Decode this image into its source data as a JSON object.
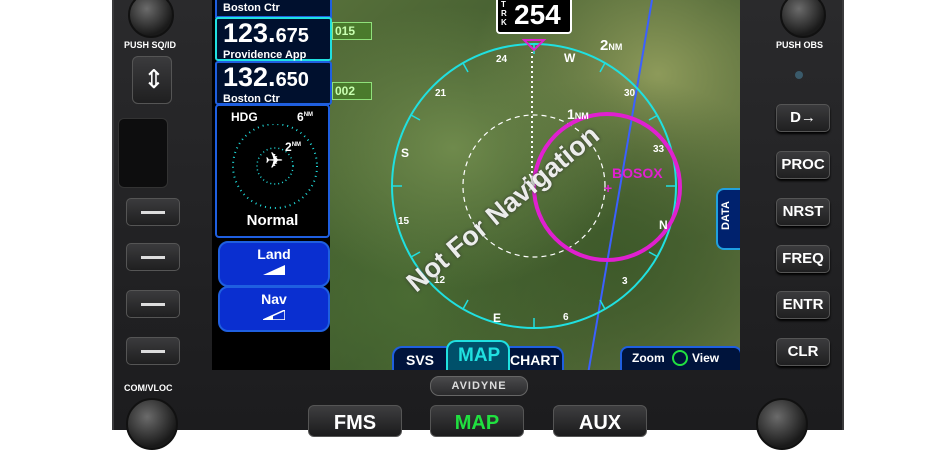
{
  "left_panel": {
    "top_label": "Boston Ctr",
    "com_active": {
      "whole": "123.",
      "decimal": "675",
      "label": "Providence App"
    },
    "com_standby": {
      "whole": "132.",
      "decimal": "650",
      "label": "Boston Ctr"
    },
    "mini_map": {
      "hdg_label": "HDG",
      "range_outer": "6",
      "range_outer_unit": "NM",
      "range_inner": "2",
      "range_inner_unit": "NM",
      "mode": "Normal"
    },
    "land_label": "Land",
    "nav_label": "Nav"
  },
  "map": {
    "track_label": "TRK",
    "heading": "254",
    "range_outer": "2",
    "range_outer_unit": "NM",
    "range_inner": "1",
    "range_inner_unit": "NM",
    "waypoint": "BOSOX",
    "alt_top": "015",
    "alt_bottom": "002",
    "compass": {
      "w": "W",
      "n": "N",
      "s": "S",
      "e": "E",
      "t24": "24",
      "t30": "30",
      "t21": "21",
      "t15": "15",
      "t12": "12",
      "t6": "6",
      "t33": "33",
      "t3": "3"
    },
    "watermark": "Not For Navigation",
    "data_tab": "DATA",
    "zoom_label": "Zoom",
    "view_label": "View"
  },
  "tabs": {
    "svs": "SVS",
    "map": "MAP",
    "chart": "CHART"
  },
  "bezel": {
    "push_sqid": "PUSH SQ/ID",
    "push_obs": "PUSH OBS",
    "com_vloc": "COM/VLOC",
    "brand": "AVIDYNE"
  },
  "right_keys": {
    "direct": "D→",
    "proc": "PROC",
    "nrst": "NRST",
    "freq": "FREQ",
    "entr": "ENTR",
    "clr": "CLR"
  },
  "bottom_keys": {
    "fms": "FMS",
    "map": "MAP",
    "aux": "AUX"
  },
  "colors": {
    "cyan": "#20e0e0",
    "magenta": "#e020d0",
    "blue": "#1f5fe0",
    "green": "#20e040"
  }
}
